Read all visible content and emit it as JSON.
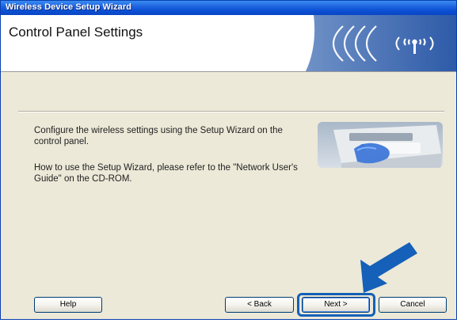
{
  "window": {
    "title": "Wireless Device Setup Wizard",
    "header_title": "Control Panel Settings"
  },
  "content": {
    "instruction_1": "Configure the wireless settings using the Setup Wizard on the control panel.",
    "instruction_2": "How to use the Setup Wizard, please refer to the \"Network User's Guide\" on the CD-ROM."
  },
  "buttons": {
    "help": "Help",
    "back": "< Back",
    "next": "Next >",
    "cancel": "Cancel"
  },
  "colors": {
    "titlebar": "#0b4fd3",
    "dialog_bg": "#ece9d8",
    "highlight": "#1560b8"
  },
  "icons": {
    "banner": "wireless-signal-icon",
    "pointer": "arrow-pointer-icon"
  }
}
